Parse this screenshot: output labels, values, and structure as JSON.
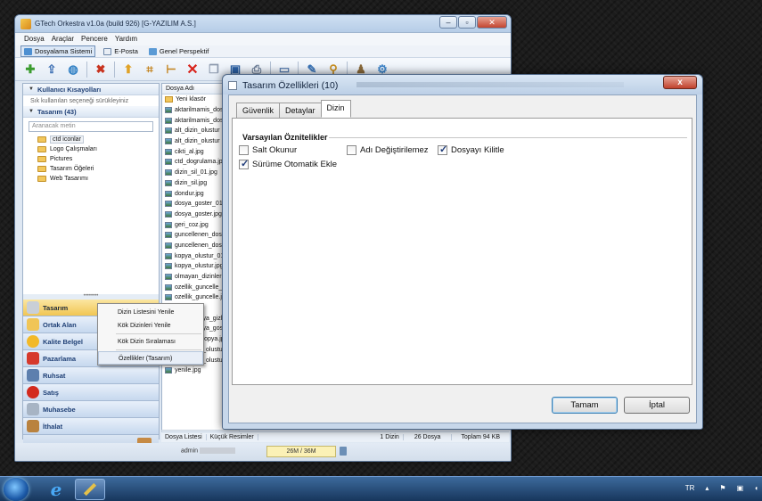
{
  "app": {
    "title": "GTech Orkestra v1.0a (build 926) [G-YAZILIM A.S.]",
    "menu": [
      "Dosya",
      "Araçlar",
      "Pencere",
      "Yardım"
    ],
    "perspectives": [
      "Dosyalama Sistemi",
      "E-Posta",
      "Genel Perspektif"
    ],
    "toolbar_icons": [
      "add-folder-icon",
      "import-icon",
      "globe-icon",
      "delete-file-icon",
      "upload-icon",
      "tree-icon",
      "branch-icon",
      "delete-icon",
      "copy-icon",
      "save-icon",
      "print-icon",
      "scan-icon",
      "edit-icon",
      "search-icon",
      "users-icon",
      "settings-icon"
    ]
  },
  "left_panel": {
    "shortcuts_title": "Kullanıcı Kısayolları",
    "shortcuts_hint": "Sık kullanılan seçeneği sürükleyiniz",
    "tree_title": "Tasarım (43)",
    "search_placeholder": "Aranacak metin",
    "folders": [
      "ctd iconlar",
      "Logo Çalışmaları",
      "Pictures",
      "Tasarım Öğeleri",
      "Web Tasarımı"
    ],
    "nav_items": [
      "Tasarım",
      "Ortak Alan",
      "Kalite Belgel",
      "Pazarlama",
      "Ruhsat",
      "Satış",
      "Muhasebe",
      "İthalat"
    ]
  },
  "file_list": {
    "header": "Dosya Adı",
    "new_folder": "Yeni klasör",
    "files": [
      "aktarilmamis_dos",
      "aktarilmamis_dos",
      "alt_dizin_olustur",
      "alt_dizin_olustur",
      "cikti_al.jpg",
      "ctd_dogrulama.jp",
      "dizin_sil_01.jpg",
      "dizin_sil.jpg",
      "dondur.jpg",
      "dosya_goster_01.",
      "dosya_goster.jpg",
      "geri_coz.jpg",
      "guncellenen_dos",
      "guncellenen_dos",
      "kopya_olustur_01",
      "kopya_olustur.jpg",
      "olmayan_dizinler",
      "ozellik_guncelle_",
      "ozellik_guncelle.j",
      "sifrele.jpg",
      "sifreli_dosya_gizle.",
      "sifreli_dosya_goste",
      "tasinmis_kopya.jpg",
      "yeni_dizin_olustu",
      "yeni_dizin_olustu",
      "yenile.jpg"
    ]
  },
  "context_menu": {
    "items": [
      "Dizin Listesini Yenile",
      "Kök Dizinleri Yenile",
      "Kök Dizin Sıralaması",
      "Özellikler (Tasarım)"
    ]
  },
  "status": {
    "tab_list": "Dosya Listesi",
    "tab_thumbs": "Küçük Resimler",
    "dirs": "1 Dizin",
    "files": "26 Dosya",
    "total": "Toplam 94 KB",
    "user": "admin",
    "memory": "26M / 36M"
  },
  "dialog": {
    "title": "Tasarım Özellikleri (10)",
    "close": "x",
    "tabs": [
      "Güvenlik",
      "Detaylar",
      "Dizin"
    ],
    "active_tab": "Dizin",
    "group_title": "Varsayılan Öznitelikler",
    "checkboxes": [
      {
        "label": "Salt Okunur",
        "checked": false
      },
      {
        "label": "Adı Değiştirilemez",
        "checked": false
      },
      {
        "label": "Dosyayı Kilitle",
        "checked": true
      },
      {
        "label": "Sürüme Otomatik Ekle",
        "checked": true
      }
    ],
    "ok_label": "Tamam",
    "cancel_label": "İptal"
  },
  "taskbar": {
    "language": "TR"
  }
}
